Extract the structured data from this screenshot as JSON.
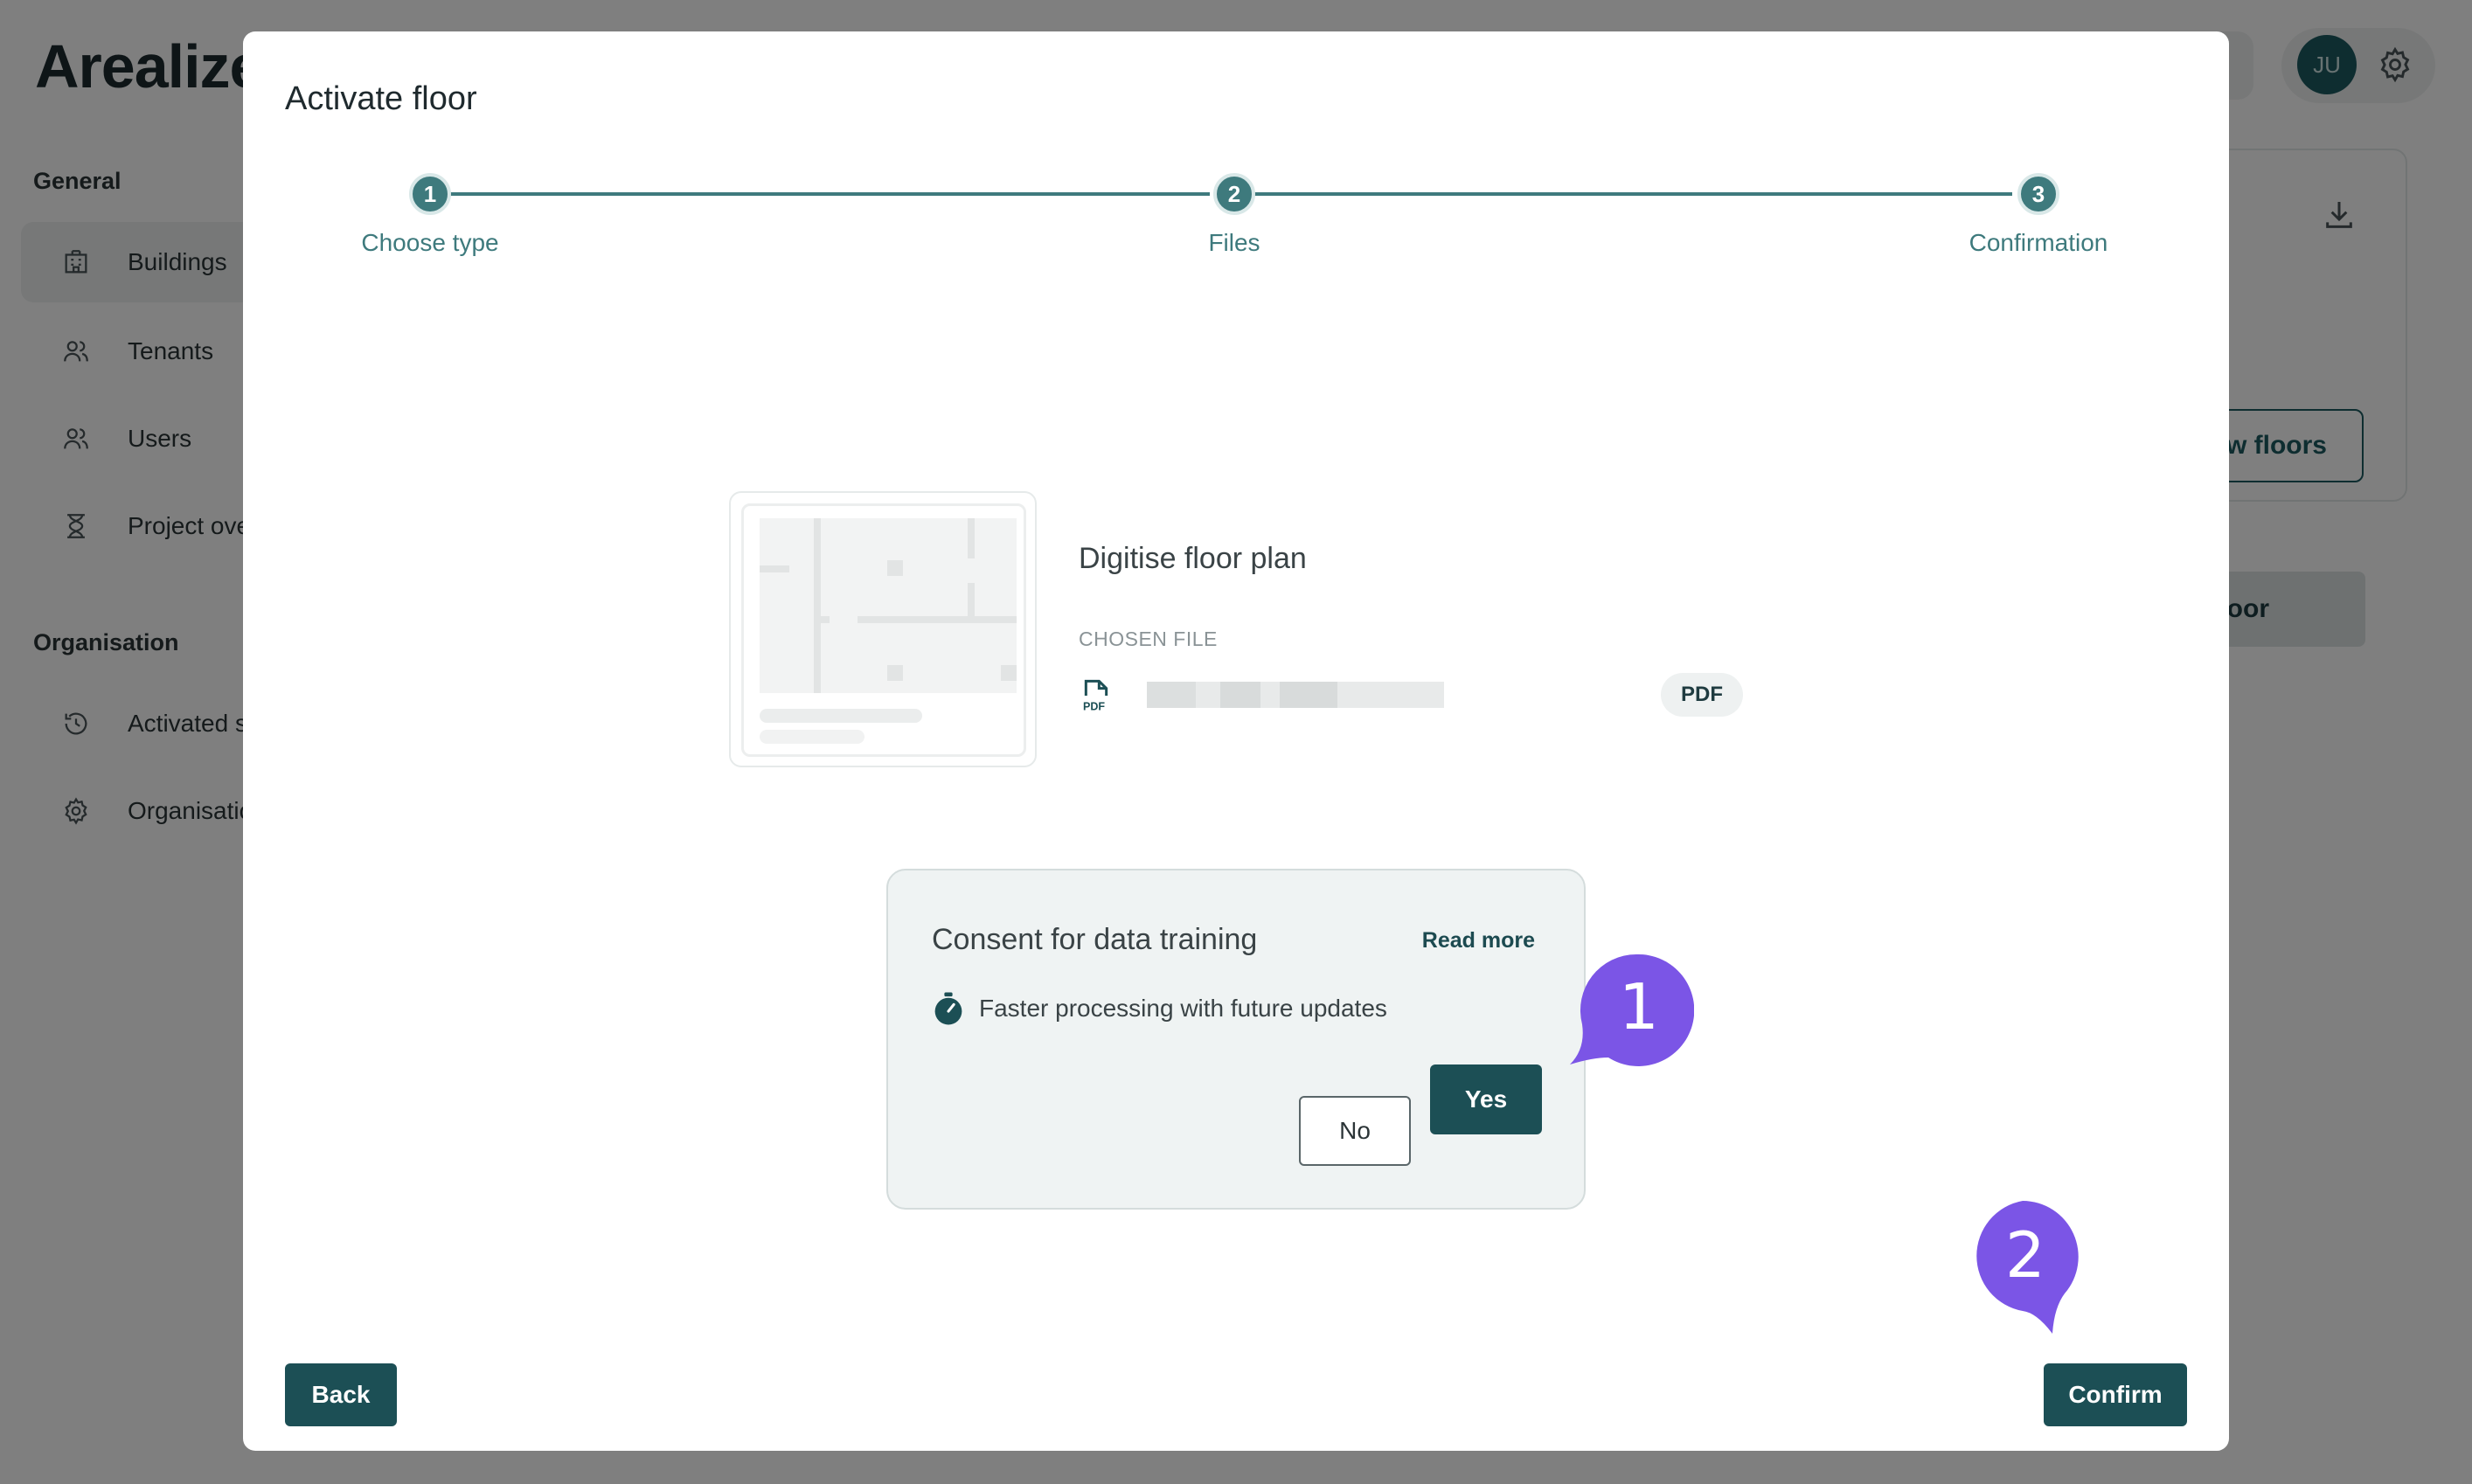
{
  "app": {
    "brand": "Arealize",
    "avatar_initials": "JU",
    "sidebar": {
      "general_heading": "General",
      "organisation_heading": "Organisation",
      "general_items": [
        {
          "label": "Buildings",
          "icon": "building-icon"
        },
        {
          "label": "Tenants",
          "icon": "users-icon"
        },
        {
          "label": "Users",
          "icon": "user-icon"
        },
        {
          "label": "Project ove",
          "icon": "hourglass-icon"
        }
      ],
      "organisation_items": [
        {
          "label": "Activated s",
          "icon": "history-icon"
        },
        {
          "label": "Organisatio",
          "icon": "gear-icon"
        }
      ]
    },
    "right_panel": {
      "outline_button": "w floors",
      "fill_button": "oor"
    }
  },
  "modal": {
    "title": "Activate floor",
    "steps": [
      {
        "number": "1",
        "label": "Choose type"
      },
      {
        "number": "2",
        "label": "Files"
      },
      {
        "number": "3",
        "label": "Confirmation"
      }
    ],
    "file": {
      "title": "Digitise floor plan",
      "chosen_label": "CHOSEN FILE",
      "badge": "PDF",
      "pdf_icon_text": "PDF"
    },
    "consent": {
      "title": "Consent for data training",
      "read_more": "Read more",
      "benefit": "Faster processing with future updates",
      "no_label": "No",
      "yes_label": "Yes"
    },
    "back_label": "Back",
    "confirm_label": "Confirm"
  },
  "annotations": [
    {
      "number": "1"
    },
    {
      "number": "2"
    }
  ],
  "colors": {
    "primary": "#1c4f55",
    "stepper": "#3e7a7d",
    "annotation": "#7b55e6",
    "overlay": "rgba(0,0,0,0.5)"
  }
}
